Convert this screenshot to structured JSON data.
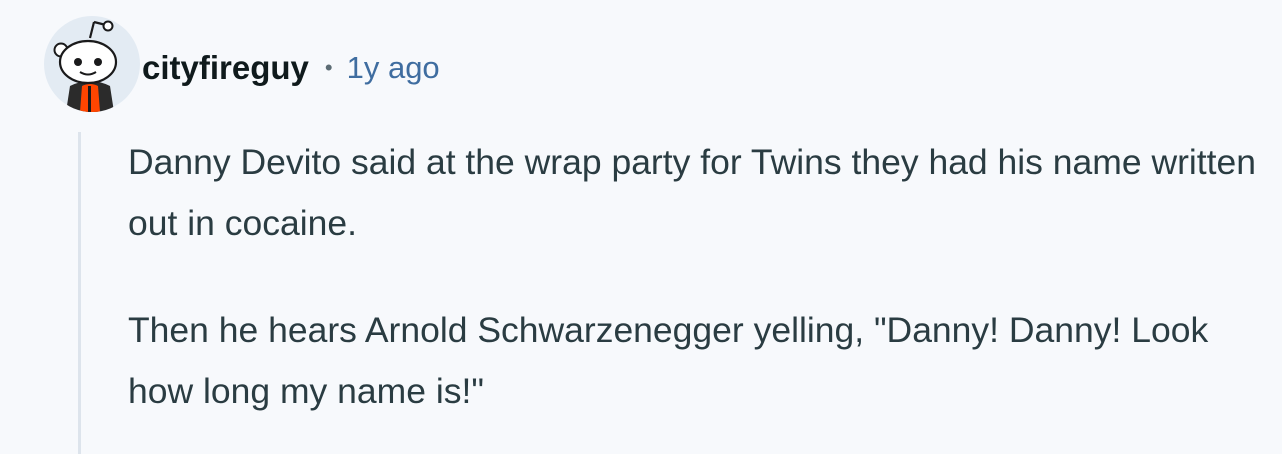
{
  "comment": {
    "author": "cityfireguy",
    "separator": "•",
    "timestamp": "1y ago",
    "paragraphs": [
      "Danny Devito said at the wrap party for Twins they had his name written out in cocaine.",
      "Then he hears Arnold Schwarzenegger yelling, \"Danny! Danny! Look how long my name is!\""
    ],
    "avatar_icon": "snoo-avatar-icon"
  },
  "colors": {
    "background": "#f7f9fc",
    "username": "#0f1a1c",
    "timestamp": "#3f6da0",
    "body_text": "#2a3c42",
    "thread_line": "#dde4ec",
    "avatar_jacket": "#ff4500"
  }
}
